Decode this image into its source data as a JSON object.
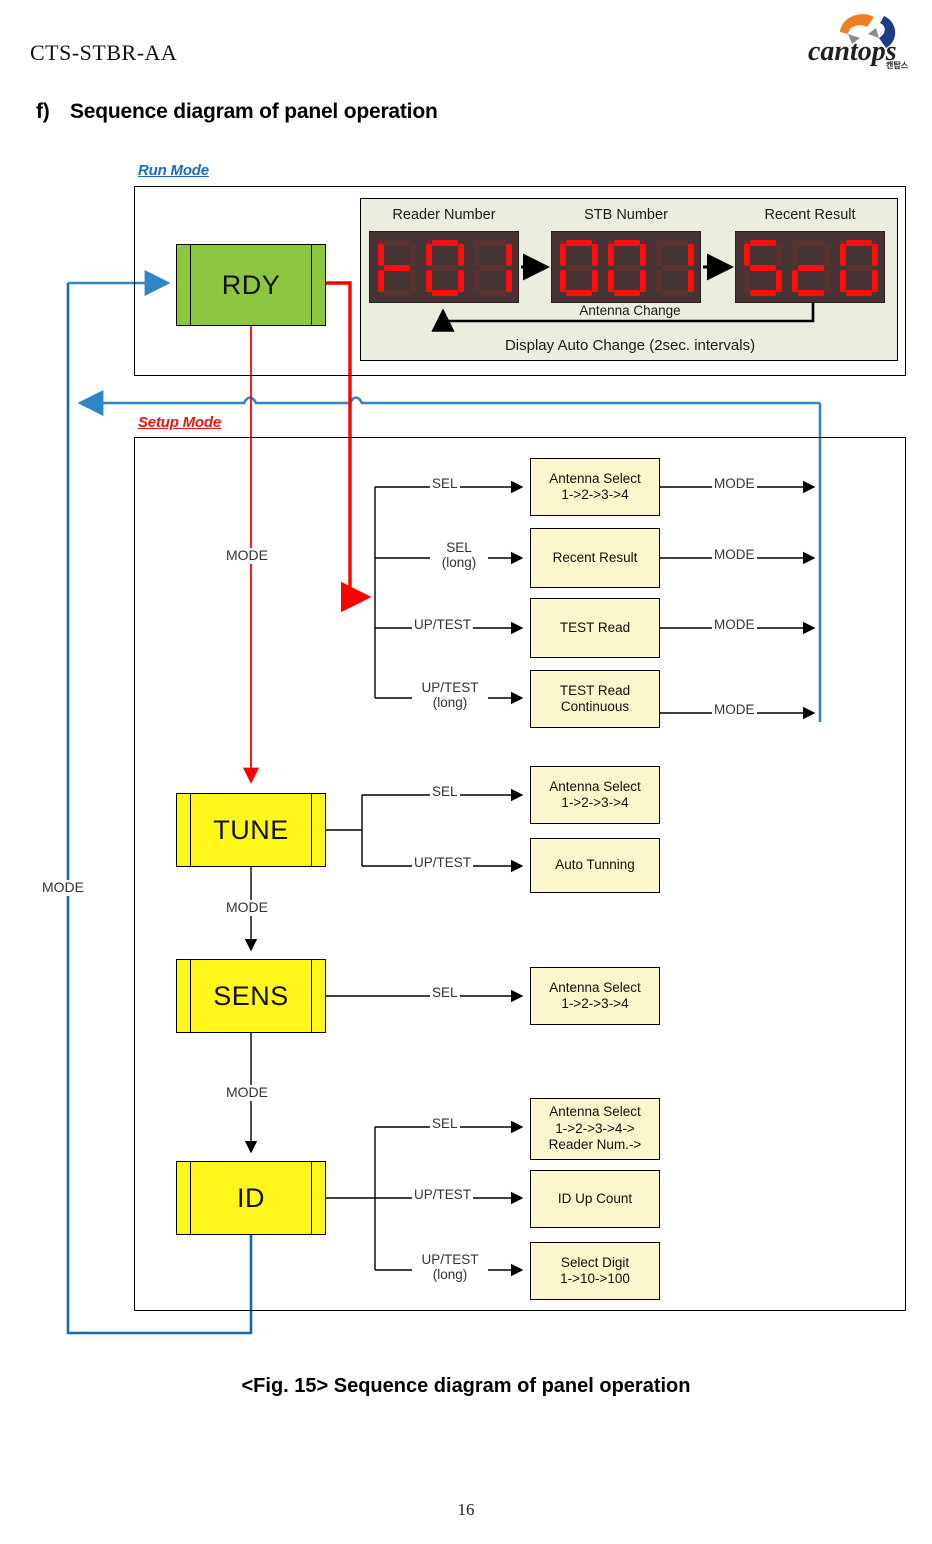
{
  "header": {
    "doc_code": "CTS-STBR-AA",
    "logo_text": "cantops",
    "logo_sub": "캔탑스"
  },
  "section": {
    "marker": "f)",
    "title": "Sequence diagram of panel operation"
  },
  "figure": {
    "caption": "<Fig. 15> Sequence diagram of panel operation",
    "page_number": "16"
  },
  "run_mode": {
    "label": "Run Mode",
    "state": "RDY",
    "panel": {
      "displays": [
        {
          "caption": "Reader Number",
          "value": "r01"
        },
        {
          "caption": "STB Number",
          "value": "001"
        },
        {
          "caption": "Recent Result",
          "value": "5c0"
        }
      ],
      "antenna_change": "Antenna Change",
      "auto_change_note": "Display Auto Change (2sec. intervals)"
    }
  },
  "setup_mode": {
    "label": "Setup Mode",
    "entry_label": "MODE",
    "left_return_label": "MODE",
    "groups": [
      {
        "state": null,
        "actions": [
          {
            "trigger": "SEL",
            "trigger_sub": "",
            "box": "Antenna Select",
            "box_sub": "1->2->3->4",
            "exit": "MODE"
          },
          {
            "trigger": "SEL",
            "trigger_sub": "(long)",
            "box": "Recent Result",
            "box_sub": "",
            "exit": "MODE"
          },
          {
            "trigger": "UP/TEST",
            "trigger_sub": "",
            "box": "TEST Read",
            "box_sub": "",
            "exit": "MODE"
          },
          {
            "trigger": "UP/TEST",
            "trigger_sub": "(long)",
            "box": "TEST Read",
            "box_sub": "Continuous",
            "exit": "MODE"
          }
        ]
      },
      {
        "state": "TUNE",
        "next_label": "MODE",
        "actions": [
          {
            "trigger": "SEL",
            "trigger_sub": "",
            "box": "Antenna Select",
            "box_sub": "1->2->3->4",
            "exit": ""
          },
          {
            "trigger": "UP/TEST",
            "trigger_sub": "",
            "box": "Auto Tunning",
            "box_sub": "",
            "exit": ""
          }
        ]
      },
      {
        "state": "SENS",
        "next_label": "MODE",
        "actions": [
          {
            "trigger": "SEL",
            "trigger_sub": "",
            "box": "Antenna Select",
            "box_sub": "1->2->3->4",
            "exit": ""
          }
        ]
      },
      {
        "state": "ID",
        "next_label": "",
        "actions": [
          {
            "trigger": "SEL",
            "trigger_sub": "",
            "box": "Antenna Select",
            "box_sub": "1->2->3->4->",
            "box_sub2": "Reader Num.->",
            "exit": ""
          },
          {
            "trigger": "UP/TEST",
            "trigger_sub": "",
            "box": "ID Up Count",
            "box_sub": "",
            "exit": ""
          },
          {
            "trigger": "UP/TEST",
            "trigger_sub": "(long)",
            "box": "Select Digit",
            "box_sub": "1->10->100",
            "exit": ""
          }
        ]
      }
    ]
  },
  "colors": {
    "run_mode_label": "#1570C0",
    "setup_mode_label": "#E8170E",
    "state_run": "#8DC63F",
    "state_setup": "#FFF61A",
    "action_box": "#FCF6CC",
    "led_background": "#453433",
    "led_on": "#FF0D0D",
    "led_off": "#5A3330",
    "panel_background": "#EBEEDE",
    "wire_return": "#2E86C8",
    "wire_entry": "#FF0000"
  }
}
